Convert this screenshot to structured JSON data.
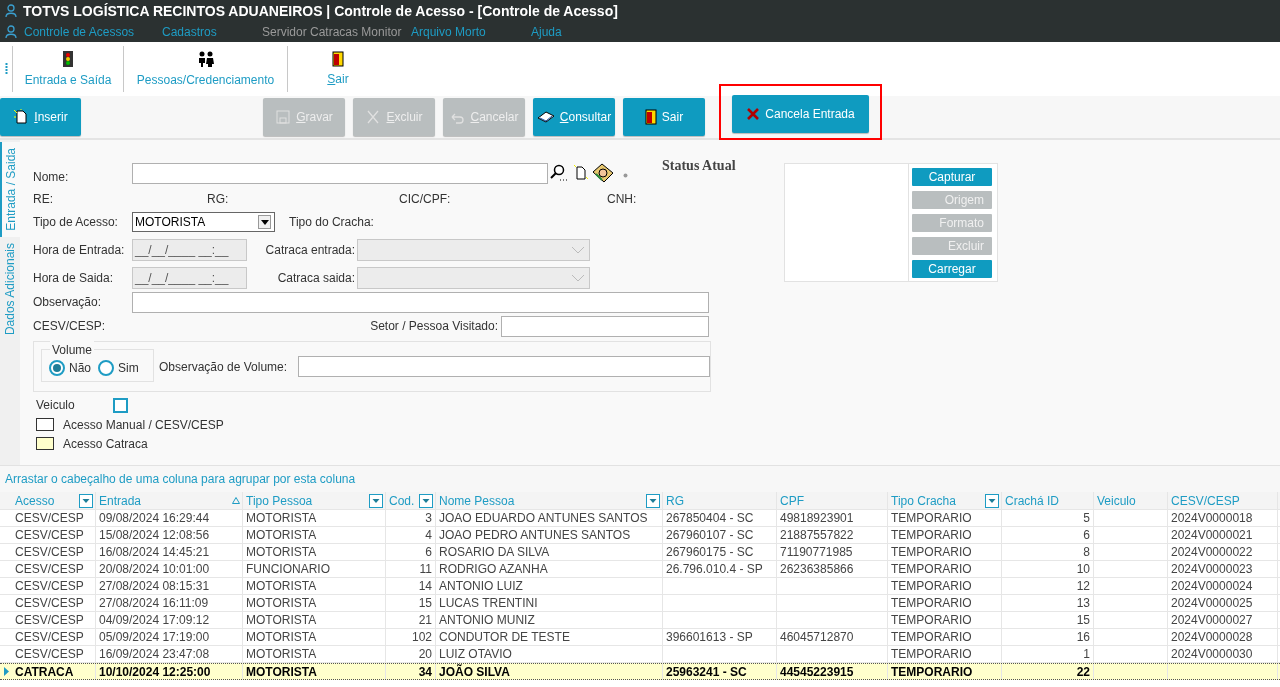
{
  "window": {
    "title": "TOTVS LOGÍSTICA RECINTOS ADUANEIROS | Controle de Acesso - [Controle de Acesso]"
  },
  "menu": [
    {
      "label": "Controle de Acessos",
      "disabled": false
    },
    {
      "label": "Cadastros",
      "disabled": false
    },
    {
      "label": "Servidor Catracas Monitor",
      "disabled": true
    },
    {
      "label": "Arquivo Morto",
      "disabled": false
    },
    {
      "label": "Ajuda",
      "disabled": false
    }
  ],
  "ribbon": [
    {
      "label": "Entrada e Saída",
      "kind": "traffic",
      "underline_first": false
    },
    {
      "label": "Pessoas/Credenciamento",
      "kind": "people",
      "underline_first": false
    },
    {
      "label": "Sair",
      "kind": "exit",
      "underline_first": true
    }
  ],
  "toolbar": [
    {
      "label": "Inserir",
      "kind": "new",
      "disabled": false,
      "highlighted": false
    },
    {
      "label": "Gravar",
      "kind": "save",
      "disabled": true,
      "highlighted": false
    },
    {
      "label": "Excluir",
      "kind": "delete",
      "disabled": true,
      "highlighted": false
    },
    {
      "label": "Cancelar",
      "kind": "undo",
      "disabled": true,
      "highlighted": false
    },
    {
      "label": "Consultar",
      "kind": "book",
      "disabled": false,
      "highlighted": false
    },
    {
      "label": "Sair",
      "kind": "exit",
      "disabled": false,
      "highlighted": false
    },
    {
      "label": "Cancela Entrada",
      "kind": "cancel",
      "disabled": false,
      "highlighted": true
    }
  ],
  "side_tabs": [
    {
      "label": "Entrada / Saida",
      "selected": true
    },
    {
      "label": "Dados Adicionais",
      "selected": false
    }
  ],
  "form": {
    "nome": "Nome:",
    "re": "RE:",
    "rg": "RG:",
    "cic": "CIC/CPF:",
    "cnh": "CNH:",
    "tipo_acesso": {
      "label": "Tipo de Acesso:",
      "value": "MOTORISTA"
    },
    "tipo_cracha": "Tipo do Cracha:",
    "hora_entrada": {
      "label": "Hora de Entrada:",
      "value": "__/__/____ __:__",
      "disabled": true
    },
    "catraca_entrada": {
      "label": "Catraca entrada:",
      "disabled": true
    },
    "hora_saida": {
      "label": "Hora de Saida:",
      "value": "__/__/____ __:__",
      "disabled": true
    },
    "catraca_saida": {
      "label": "Catraca saida:",
      "disabled": true
    },
    "observacao": "Observação:",
    "cesv": "CESV/CESP:",
    "setor": "Setor / Pessoa Visitado:",
    "volume": {
      "legend": "Volume",
      "options": [
        {
          "label": "Não",
          "selected": true
        },
        {
          "label": "Sim",
          "selected": false
        }
      ],
      "obs_label": "Observação de Volume:"
    },
    "veiculo": {
      "label": "Veiculo",
      "checked": false
    },
    "legend": [
      {
        "label": "Acesso Manual / CESV/CESP",
        "color": "#ffffff"
      },
      {
        "label": "Acesso Catraca",
        "color": "#ffffcc"
      }
    ]
  },
  "status": {
    "title": "Status Atual",
    "buttons": [
      {
        "label": "Capturar",
        "disabled": false
      },
      {
        "label": "Origem",
        "disabled": true
      },
      {
        "label": "Formato",
        "disabled": true
      },
      {
        "label": "Excluir",
        "disabled": true
      },
      {
        "label": "Carregar",
        "disabled": false
      }
    ]
  },
  "grid": {
    "group_hint": "Arrastar o cabeçalho de uma coluna para agrupar por esta coluna",
    "columns": [
      {
        "label": "Acesso",
        "filter": true,
        "sorted": false
      },
      {
        "label": "Entrada",
        "filter": false,
        "sorted": true
      },
      {
        "label": "Tipo Pessoa",
        "filter": true,
        "sorted": false
      },
      {
        "label": "Cod.",
        "filter": true,
        "sorted": false
      },
      {
        "label": "Nome Pessoa",
        "filter": true,
        "sorted": false
      },
      {
        "label": "RG",
        "filter": false,
        "sorted": false
      },
      {
        "label": "CPF",
        "filter": false,
        "sorted": false
      },
      {
        "label": "Tipo Cracha",
        "filter": true,
        "sorted": false
      },
      {
        "label": "Crachá ID",
        "filter": false,
        "sorted": false
      },
      {
        "label": "Veiculo",
        "filter": false,
        "sorted": false
      },
      {
        "label": "CESV/CESP",
        "filter": false,
        "sorted": false
      }
    ],
    "rows": [
      {
        "selected": false,
        "cells": [
          "CESV/CESP",
          "09/08/2024 16:29:44",
          "MOTORISTA",
          "3",
          "JOAO EDUARDO ANTUNES SANTOS",
          "267850404 - SC",
          "49818923901",
          "TEMPORARIO",
          "5",
          "",
          "2024V0000018"
        ]
      },
      {
        "selected": false,
        "cells": [
          "CESV/CESP",
          "15/08/2024 12:08:56",
          "MOTORISTA",
          "4",
          "JOAO PEDRO ANTUNES SANTOS",
          "267960107 - SC",
          "21887557822",
          "TEMPORARIO",
          "6",
          "",
          "2024V0000021"
        ]
      },
      {
        "selected": false,
        "cells": [
          "CESV/CESP",
          "16/08/2024 14:45:21",
          "MOTORISTA",
          "6",
          "ROSARIO DA SILVA",
          "267960175 - SC",
          "71190771985",
          "TEMPORARIO",
          "8",
          "",
          "2024V0000022"
        ]
      },
      {
        "selected": false,
        "cells": [
          "CESV/CESP",
          "20/08/2024 10:01:00",
          "FUNCIONARIO",
          "11",
          "RODRIGO AZANHA",
          "26.796.010.4 - SP",
          "26236385866",
          "TEMPORARIO",
          "10",
          "",
          "2024V0000023"
        ]
      },
      {
        "selected": false,
        "cells": [
          "CESV/CESP",
          "27/08/2024 08:15:31",
          "MOTORISTA",
          "14",
          "ANTONIO LUIZ",
          "",
          "",
          "TEMPORARIO",
          "12",
          "",
          "2024V0000024"
        ]
      },
      {
        "selected": false,
        "cells": [
          "CESV/CESP",
          "27/08/2024 16:11:09",
          "MOTORISTA",
          "15",
          "LUCAS TRENTINI",
          "",
          "",
          "TEMPORARIO",
          "13",
          "",
          "2024V0000025"
        ]
      },
      {
        "selected": false,
        "cells": [
          "CESV/CESP",
          "04/09/2024 17:09:12",
          "MOTORISTA",
          "21",
          "ANTONIO MUNIZ",
          "",
          "",
          "TEMPORARIO",
          "15",
          "",
          "2024V0000027"
        ]
      },
      {
        "selected": false,
        "cells": [
          "CESV/CESP",
          "05/09/2024 17:19:00",
          "MOTORISTA",
          "102",
          "CONDUTOR DE TESTE",
          "396601613 - SP",
          "46045712870",
          "TEMPORARIO",
          "16",
          "",
          "2024V0000028"
        ]
      },
      {
        "selected": false,
        "cells": [
          "CESV/CESP",
          "16/09/2024 23:47:08",
          "MOTORISTA",
          "20",
          "LUIZ OTAVIO",
          "",
          "",
          "TEMPORARIO",
          "1",
          "",
          "2024V0000030"
        ]
      },
      {
        "selected": true,
        "cells": [
          "CATRACA",
          "10/10/2024 12:25:00",
          "MOTORISTA",
          "34",
          "JOÃO SILVA",
          "25963241 - SC",
          "44545223915",
          "TEMPORARIO",
          "22",
          "",
          ""
        ]
      }
    ]
  }
}
